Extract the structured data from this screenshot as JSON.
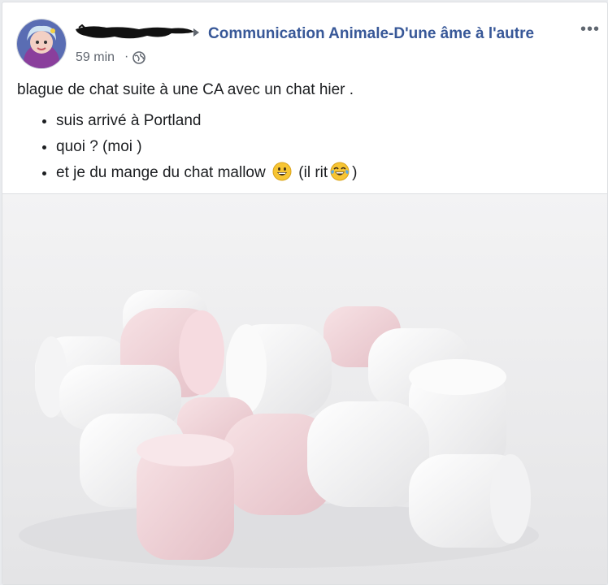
{
  "post": {
    "group_name": "Communication Animale-D'une âme à l'autre",
    "timestamp": "59 min",
    "separator": "·",
    "privacy_icon": "globe-icon",
    "more_icon": "more-options-icon",
    "text": {
      "intro": "blague de chat suite à une CA avec un chat hier .",
      "bullets": {
        "item1": "suis arrivé à Portland",
        "item2": "quoi ? (moi )",
        "item3_before": "et je du mange du chat mallow",
        "item3_middle": "(il rit",
        "item3_after": ")"
      }
    },
    "photo": {
      "subject": "marshmallows",
      "tint_pink": "#f2d4d8",
      "tint_white": "#fbfbfb"
    }
  },
  "colors": {
    "link": "#385898",
    "meta": "#616770",
    "text": "#1c1e21",
    "bg": "#e9ebee"
  }
}
